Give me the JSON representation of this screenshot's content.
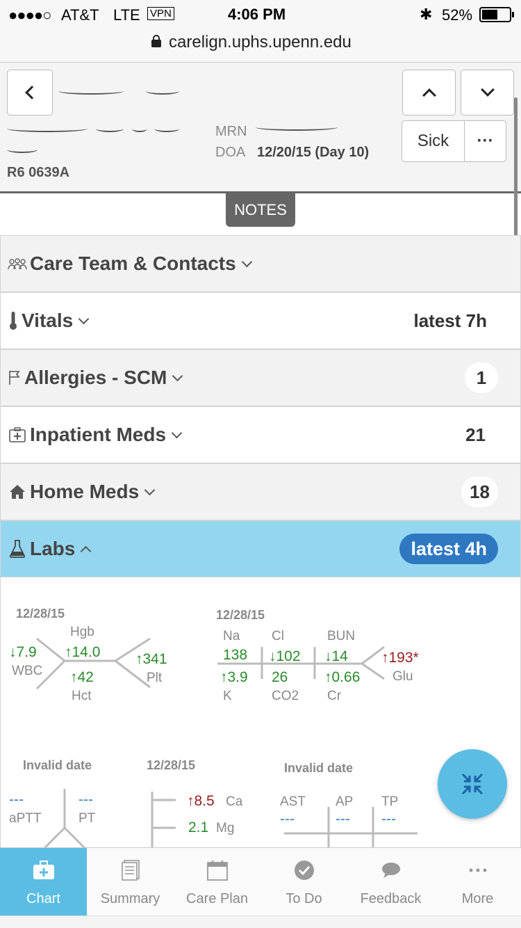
{
  "status_bar": {
    "signal": "●●●●○",
    "carrier": "AT&T",
    "network": "LTE",
    "vpn": "VPN",
    "time": "4:06 PM",
    "bluetooth": "✱",
    "battery": "52%"
  },
  "url_bar": {
    "url": "carelign.uphs.upenn.edu"
  },
  "patient": {
    "mrn_label": "MRN",
    "doa_label": "DOA",
    "doa_value": "12/20/15 (Day 10)",
    "room": "R6 0639A",
    "sick_label": "Sick",
    "more_label": "···"
  },
  "notes_tab": "NOTES",
  "sections": {
    "care_team": {
      "title": "Care Team & Contacts"
    },
    "vitals": {
      "title": "Vitals",
      "right": "latest 7h"
    },
    "allergies": {
      "title": "Allergies - SCM",
      "count": "1"
    },
    "inpatient_meds": {
      "title": "Inpatient Meds",
      "count": "21"
    },
    "home_meds": {
      "title": "Home Meds",
      "count": "18"
    },
    "labs": {
      "title": "Labs",
      "badge": "latest 4h"
    }
  },
  "labs": {
    "cbc": {
      "date": "12/28/15",
      "wbc": "↓7.9",
      "wbc_label": "WBC",
      "hgb_label": "Hgb",
      "hgb": "↑14.0",
      "hct": "↑42",
      "hct_label": "Hct",
      "plt": "↑341",
      "plt_label": "Plt"
    },
    "bmp": {
      "date": "12/28/15",
      "na_label": "Na",
      "na": "138",
      "k": "↑3.9",
      "k_label": "K",
      "cl_label": "Cl",
      "cl": "↓102",
      "co2": "26",
      "co2_label": "CO2",
      "bun_label": "BUN",
      "bun": "↓14",
      "cr": "↑0.66",
      "cr_label": "Cr",
      "glu": "↑193*",
      "glu_label": "Glu"
    },
    "coag": {
      "date": "Invalid date",
      "aptt": "---",
      "aptt_label": "aPTT",
      "pt": "---",
      "pt_label": "PT"
    },
    "ca_mg": {
      "date": "12/28/15",
      "ca": "↑8.5",
      "ca_label": "Ca",
      "mg": "2.1",
      "mg_label": "Mg"
    },
    "lft": {
      "date": "Invalid date",
      "ast_label": "AST",
      "ast": "---",
      "ap_label": "AP",
      "ap": "---",
      "tp_label": "TP",
      "tp": "---"
    }
  },
  "tab_bar": {
    "tabs": [
      {
        "label": "Chart",
        "icon": "medical-bag-icon"
      },
      {
        "label": "Summary",
        "icon": "document-icon"
      },
      {
        "label": "Care Plan",
        "icon": "calendar-icon"
      },
      {
        "label": "To Do",
        "icon": "checkmark-circle-icon"
      },
      {
        "label": "Feedback",
        "icon": "chat-bubble-icon"
      },
      {
        "label": "More",
        "icon": "ellipsis-icon"
      }
    ]
  },
  "colors": {
    "accent": "#5bbde3",
    "labs_header": "#94d6f0",
    "badge_blue": "#2e78c2",
    "normal_value": "#2a8a2a",
    "abnormal_value": "#9a1c1c"
  }
}
